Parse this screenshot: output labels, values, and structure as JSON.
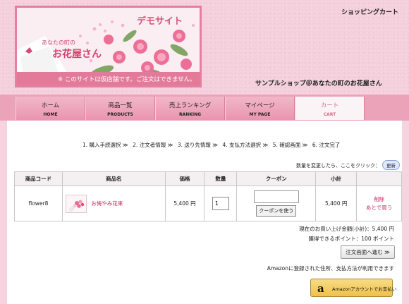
{
  "header": {
    "banner_demo": "デモサイト",
    "banner_tagline": "あなたの町の",
    "banner_shopname": "お花屋さん",
    "banner_notice": "※ このサイトは仮店舗です。ご注文はできません。",
    "cart_title": "ショッピングカート",
    "shop_subtitle": "サンプルショップ＠あなたの町のお花屋さん"
  },
  "nav": {
    "items": [
      {
        "jp": "ホーム",
        "en": "HOME"
      },
      {
        "jp": "商品一覧",
        "en": "PRODUCTS"
      },
      {
        "jp": "売上ランキング",
        "en": "RANKING"
      },
      {
        "jp": "マイページ",
        "en": "MY PAGE"
      },
      {
        "jp": "カート",
        "en": "CART"
      }
    ]
  },
  "steps": [
    "1. 購入手続選択 ≫",
    "2. 注文者情報 ≫",
    "3. 送り先情報 ≫",
    "4. 支払方法選択 ≫",
    "5. 確認画面 ≫",
    "6. 注文完了"
  ],
  "quantity_note": "数量を変更したら、ここをクリック：",
  "update_button": "更新",
  "table": {
    "headers": [
      "商品コード",
      "商品名",
      "価格",
      "数量",
      "クーポン",
      "小計",
      ""
    ],
    "row": {
      "code": "flower8",
      "name": "お悔やみ花束",
      "price": "5,400 円",
      "quantity": "1",
      "coupon_button": "クーポンを使う",
      "subtotal": "5,400 円",
      "delete": "削除",
      "buy_later": "あとで買う"
    }
  },
  "totals": {
    "line1": "現在のお買い上げ金額(小計)：5,400 円",
    "line2": "獲得できるポイント：100 ポイント"
  },
  "next_button": "注文画面へ進む ≫",
  "amazon_note": "Amazonに登録された住所、支払方法が利用できます",
  "amazon_button": "Amazonアカウントでお支払い",
  "amazon_logo": "a",
  "colors": {
    "accent": "#e57f9f",
    "link": "#c8285a",
    "nav_bg": "#eaa3b8"
  }
}
